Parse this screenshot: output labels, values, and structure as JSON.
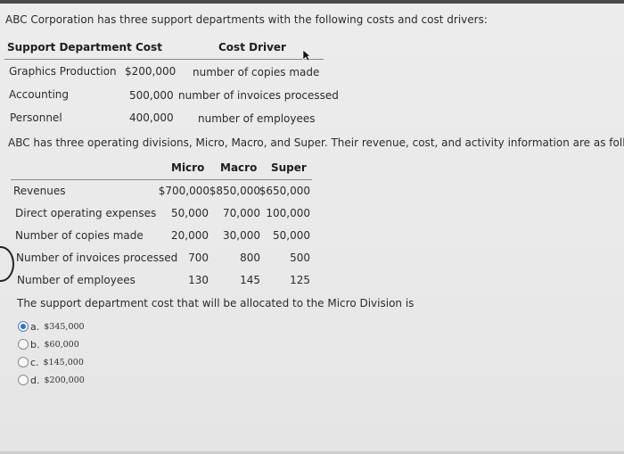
{
  "intro": "ABC Corporation has three support departments with the following costs and cost drivers:",
  "support_table": {
    "headers": [
      "Support Department",
      "Cost",
      "Cost Driver"
    ],
    "rows": [
      {
        "department": "Graphics Production",
        "cost": "$200,000",
        "driver": "number of copies made"
      },
      {
        "department": "Accounting",
        "cost": "500,000",
        "driver": "number of invoices processed"
      },
      {
        "department": "Personnel",
        "cost": "400,000",
        "driver": "number of employees"
      }
    ]
  },
  "divisions_intro": "ABC has three operating divisions, Micro, Macro, and Super. Their revenue, cost, and activity information are as follows:",
  "division_table": {
    "headers": [
      "Micro",
      "Macro",
      "Super"
    ],
    "rows": [
      {
        "label": "Revenues",
        "values": [
          "$700,000",
          "$850,000",
          "$650,000"
        ]
      },
      {
        "label": "Direct operating expenses",
        "values": [
          "50,000",
          "70,000",
          "100,000"
        ]
      },
      {
        "label": "Number of copies made",
        "values": [
          "20,000",
          "30,000",
          "50,000"
        ]
      },
      {
        "label": "Number of invoices processed",
        "values": [
          "700",
          "800",
          "500"
        ]
      },
      {
        "label": "Number of employees",
        "values": [
          "130",
          "145",
          "125"
        ]
      }
    ]
  },
  "question": "The support department cost that will be allocated to the Micro Division is",
  "options": [
    {
      "letter": "a.",
      "value": "$345,000",
      "selected": true
    },
    {
      "letter": "b.",
      "value": "$60,000",
      "selected": false
    },
    {
      "letter": "c.",
      "value": "$145,000",
      "selected": false
    },
    {
      "letter": "d.",
      "value": "$200,000",
      "selected": false
    }
  ],
  "icons": {
    "cursor": "mouse-pointer-icon",
    "radio_selected": "radio-selected-icon",
    "radio": "radio-icon"
  }
}
